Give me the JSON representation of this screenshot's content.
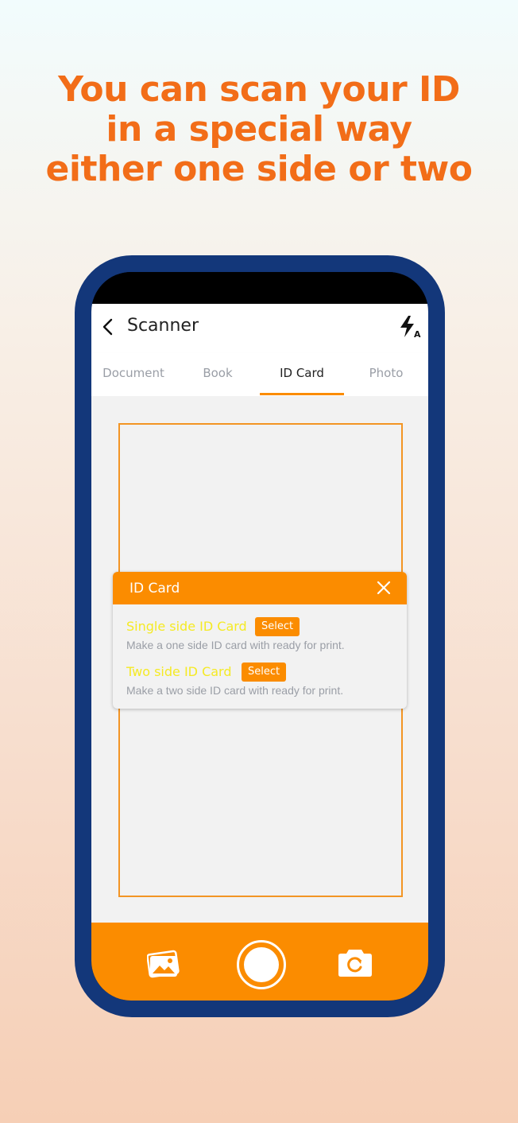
{
  "headline": {
    "line1": "You can scan your ID",
    "line2": "in a special way",
    "line3": "either one side or two"
  },
  "app": {
    "title": "Scanner",
    "back_icon": "chevron-left-icon",
    "flash_icon": "flash-auto-icon",
    "tabs": [
      {
        "label": "Document",
        "active": false
      },
      {
        "label": "Book",
        "active": false
      },
      {
        "label": "ID Card",
        "active": true
      },
      {
        "label": "Photo",
        "active": false
      }
    ]
  },
  "dialog": {
    "title": "ID Card",
    "close_icon": "close-icon",
    "options": [
      {
        "title": "Single side ID Card",
        "button": "Select",
        "description": "Make a one side ID card with ready for print."
      },
      {
        "title": "Two side ID Card",
        "button": "Select",
        "description": "Make a two side ID card with ready for print."
      }
    ]
  },
  "bottom_bar": {
    "gallery_icon": "gallery-icon",
    "shutter_icon": "shutter-icon",
    "switch_camera_icon": "switch-camera-icon"
  },
  "colors": {
    "accent": "#fb8c00",
    "headline": "#f26d18",
    "phone_frame": "#13377a",
    "option_title": "#f5ea24"
  }
}
